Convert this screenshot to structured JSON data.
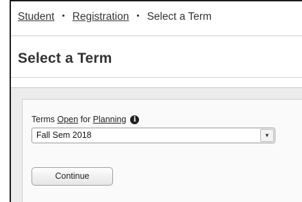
{
  "breadcrumb": {
    "student": "Student",
    "separator1": "•",
    "registration": "Registration",
    "separator2": "•",
    "current": "Select a Term"
  },
  "page": {
    "title": "Select a Term"
  },
  "term_field": {
    "label_part1": "Terms ",
    "label_open": "Open",
    "label_part2": " for ",
    "label_planning": "Planning",
    "info_icon": "info-icon",
    "selected_value": "Fall Sem 2018",
    "arrow_icon": "chevron-down-icon"
  },
  "actions": {
    "continue_label": "Continue"
  }
}
